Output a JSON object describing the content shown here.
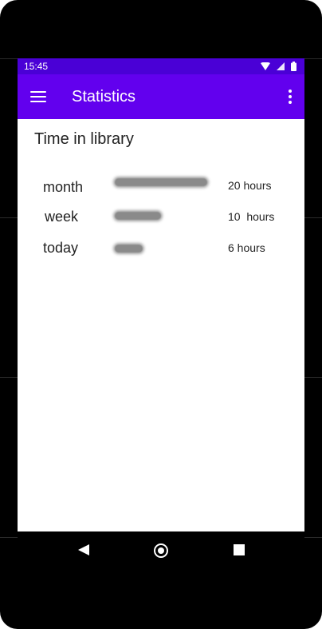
{
  "status_bar": {
    "time": "15:45",
    "icons": [
      "wifi-icon",
      "signal-icon",
      "battery-icon"
    ]
  },
  "app_bar": {
    "title": "Statistics",
    "menu_icon": "hamburger-menu-icon",
    "more_icon": "more-vertical-icon"
  },
  "section": {
    "title": "Time in library"
  },
  "stats": [
    {
      "label": "month",
      "value_text": "20 hours",
      "hours": 20
    },
    {
      "label": "week",
      "value_text": "10  hours",
      "hours": 10
    },
    {
      "label": "today",
      "value_text": "6 hours",
      "hours": 6
    }
  ],
  "nav_bar": {
    "icons": [
      "back-icon",
      "home-icon",
      "recent-apps-icon"
    ]
  },
  "colors": {
    "status_bar": "#4a00d6",
    "app_bar": "#6200ee",
    "bar": "#8a8a8a"
  }
}
